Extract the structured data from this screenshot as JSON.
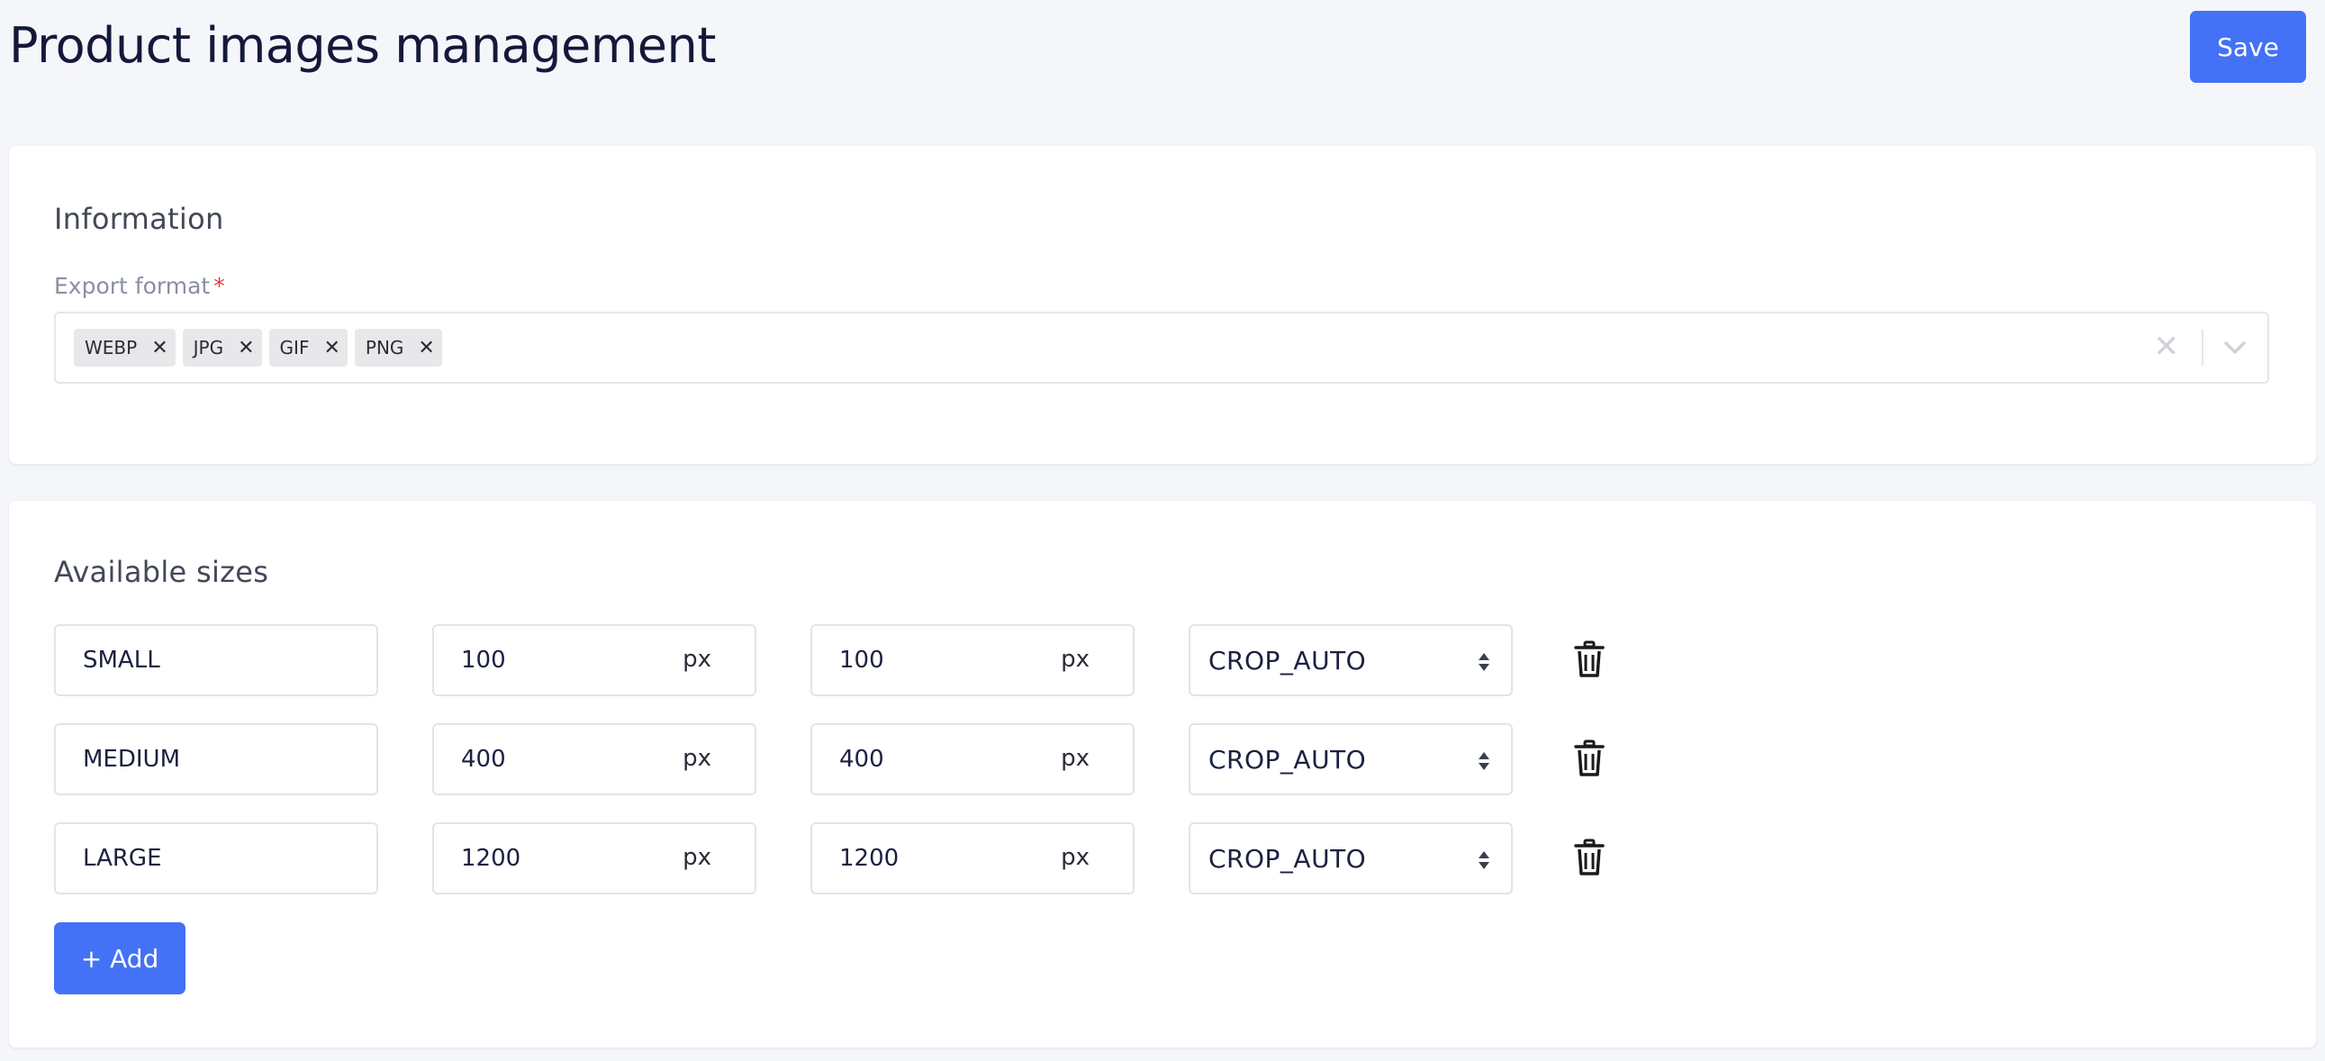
{
  "header": {
    "title": "Product images management",
    "save_label": "Save"
  },
  "information": {
    "title": "Information",
    "export_format": {
      "label": "Export format",
      "required_mark": "*",
      "chips": [
        "WEBP",
        "JPG",
        "GIF",
        "PNG"
      ],
      "chip_remove_glyph": "✕",
      "clear_glyph": "✕"
    }
  },
  "sizes": {
    "title": "Available sizes",
    "unit": "px",
    "rows": [
      {
        "name": "SMALL",
        "width": "100",
        "height": "100",
        "mode": "CROP_AUTO"
      },
      {
        "name": "MEDIUM",
        "width": "400",
        "height": "400",
        "mode": "CROP_AUTO"
      },
      {
        "name": "LARGE",
        "width": "1200",
        "height": "1200",
        "mode": "CROP_AUTO"
      }
    ],
    "add_label": "+ Add"
  },
  "colors": {
    "primary": "#4372f6",
    "required": "#e03b3b",
    "background": "#f5f6fa"
  },
  "icons": {
    "remove": "close-icon",
    "dropdown": "chevron-down-icon",
    "select": "sort-icon",
    "delete": "trash-icon"
  }
}
